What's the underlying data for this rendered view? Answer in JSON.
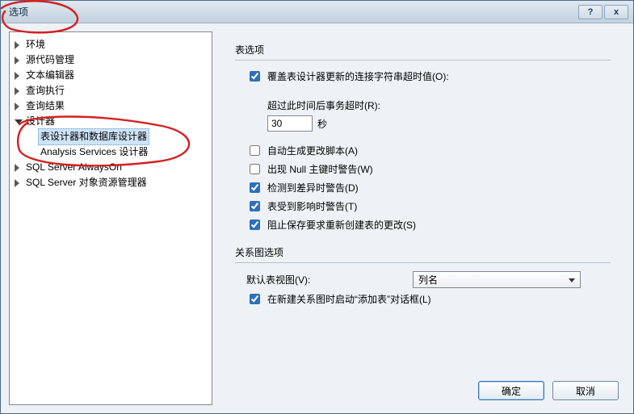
{
  "window": {
    "title": "选项"
  },
  "winbuttons": {
    "help": "?",
    "close": "x"
  },
  "tree": {
    "items": [
      {
        "label": "环境"
      },
      {
        "label": "源代码管理"
      },
      {
        "label": "文本编辑器"
      },
      {
        "label": "查询执行"
      },
      {
        "label": "查询结果"
      },
      {
        "label": "设计器",
        "children": [
          {
            "label": "表设计器和数据库设计器"
          },
          {
            "label": "Analysis Services 设计器"
          }
        ]
      },
      {
        "label": "SQL Server AlwaysOn"
      },
      {
        "label": "SQL Server 对象资源管理器"
      }
    ]
  },
  "group1": {
    "title": "表选项",
    "override": {
      "label": "覆盖表设计器更新的连接字符串超时值(O):",
      "checked": true
    },
    "timeout": {
      "label": "超过此时间后事务超时(R):",
      "value": "30",
      "suffix": "秒"
    },
    "autoScript": {
      "label": "自动生成更改脚本(A)",
      "checked": false
    },
    "nullWarn": {
      "label": "出现 Null 主键时警告(W)",
      "checked": false
    },
    "diffWarn": {
      "label": "检测到差异时警告(D)",
      "checked": true
    },
    "affectWarn": {
      "label": "表受到影响时警告(T)",
      "checked": true
    },
    "preventSave": {
      "label": "阻止保存要求重新创建表的更改(S)",
      "checked": true
    }
  },
  "group2": {
    "title": "关系图选项",
    "defaultView": {
      "label": "默认表视图(V):",
      "value": "列名"
    },
    "launchAdd": {
      "label": "在新建关系图时启动“添加表”对话框(L)",
      "checked": true
    }
  },
  "buttons": {
    "ok": "确定",
    "cancel": "取消"
  }
}
